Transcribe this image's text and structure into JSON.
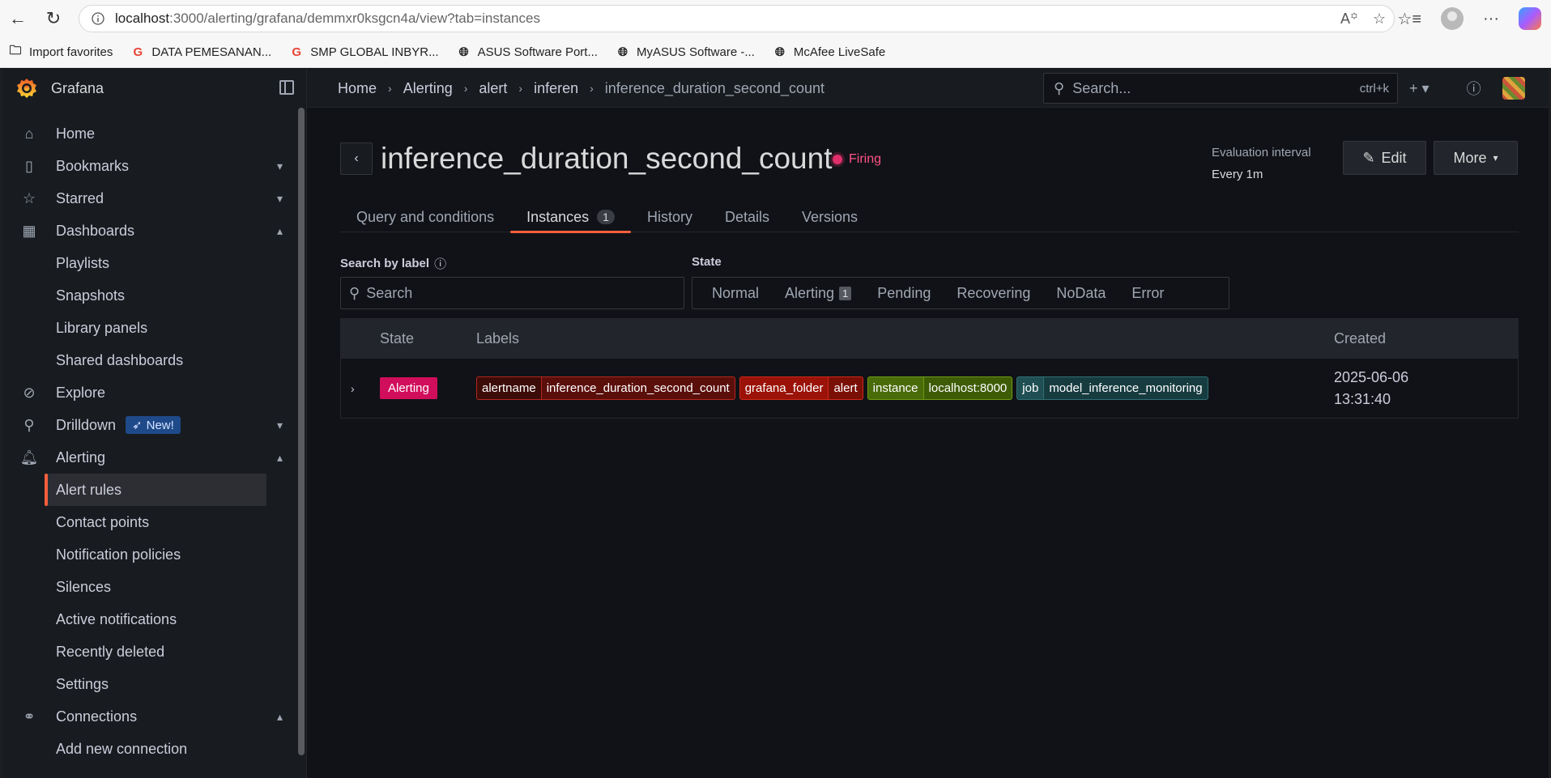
{
  "browser": {
    "url_host": "localhost",
    "url_path": ":3000/alerting/grafana/demmxr0ksgcn4a/view?tab=instances",
    "favorites": [
      {
        "label": "Import favorites",
        "icon": "folder-icon"
      },
      {
        "label": "DATA PEMESANAN...",
        "icon": "google-icon"
      },
      {
        "label": "SMP GLOBAL INBYR...",
        "icon": "google-icon"
      },
      {
        "label": "ASUS Software Port...",
        "icon": "globe-icon"
      },
      {
        "label": "MyASUS Software -...",
        "icon": "globe-icon"
      },
      {
        "label": "McAfee LiveSafe",
        "icon": "globe-icon"
      }
    ]
  },
  "app": {
    "brand": "Grafana",
    "search_placeholder": "Search...",
    "search_shortcut": "ctrl+k"
  },
  "sidebar": {
    "items": [
      {
        "label": "Home",
        "icon": "home-icon"
      },
      {
        "label": "Bookmarks",
        "icon": "bookmark-icon",
        "chevron": "⌄"
      },
      {
        "label": "Starred",
        "icon": "star-icon",
        "chevron": "⌄"
      },
      {
        "label": "Dashboards",
        "icon": "dashboards-icon",
        "chevron": "⌃"
      },
      {
        "label": "Playlists",
        "sub": true
      },
      {
        "label": "Snapshots",
        "sub": true
      },
      {
        "label": "Library panels",
        "sub": true
      },
      {
        "label": "Shared dashboards",
        "sub": true
      },
      {
        "label": "Explore",
        "icon": "compass-icon"
      },
      {
        "label": "Drilldown",
        "icon": "drilldown-icon",
        "chevron": "⌄",
        "badge": "New!"
      },
      {
        "label": "Alerting",
        "icon": "bell-icon",
        "chevron": "⌃"
      },
      {
        "label": "Alert rules",
        "sub": true,
        "active": true
      },
      {
        "label": "Contact points",
        "sub": true
      },
      {
        "label": "Notification policies",
        "sub": true
      },
      {
        "label": "Silences",
        "sub": true
      },
      {
        "label": "Active notifications",
        "sub": true
      },
      {
        "label": "Recently deleted",
        "sub": true
      },
      {
        "label": "Settings",
        "sub": true
      },
      {
        "label": "Connections",
        "icon": "connections-icon",
        "chevron": "⌃"
      },
      {
        "label": "Add new connection",
        "sub": true
      }
    ]
  },
  "breadcrumb": [
    "Home",
    "Alerting",
    "alert",
    "inferen",
    "inference_duration_second_count"
  ],
  "rule": {
    "title": "inference_duration_second_count",
    "status": "Firing",
    "eval_label": "Evaluation interval",
    "eval_value": "Every 1m",
    "edit_label": "Edit",
    "more_label": "More"
  },
  "tabs": [
    {
      "label": "Query and conditions"
    },
    {
      "label": "Instances",
      "count": "1",
      "active": true
    },
    {
      "label": "History"
    },
    {
      "label": "Details"
    },
    {
      "label": "Versions"
    }
  ],
  "filters": {
    "search_label": "Search by label",
    "search_placeholder": "Search",
    "state_label": "State",
    "states": [
      {
        "label": "Normal"
      },
      {
        "label": "Alerting",
        "count": "1"
      },
      {
        "label": "Pending"
      },
      {
        "label": "Recovering"
      },
      {
        "label": "NoData"
      },
      {
        "label": "Error"
      }
    ]
  },
  "table": {
    "headers": {
      "state": "State",
      "labels": "Labels",
      "created": "Created"
    },
    "rows": [
      {
        "state": "Alerting",
        "labels": [
          {
            "key": "alertname",
            "value": "inference_duration_second_count",
            "color": "#8a1a12"
          },
          {
            "key": "grafana_folder",
            "value": "alert",
            "color": "#a3140a"
          },
          {
            "key": "instance",
            "value": "localhost:8000",
            "color": "#4a6b0a"
          },
          {
            "key": "job",
            "value": "model_inference_monitoring",
            "color": "#1f4f52"
          }
        ],
        "created_date": "2025-06-06",
        "created_time": "13:31:40"
      }
    ]
  },
  "colors": {
    "accent": "#f55f3e",
    "alerting": "#d10e5c",
    "firing": "#ff5286"
  }
}
